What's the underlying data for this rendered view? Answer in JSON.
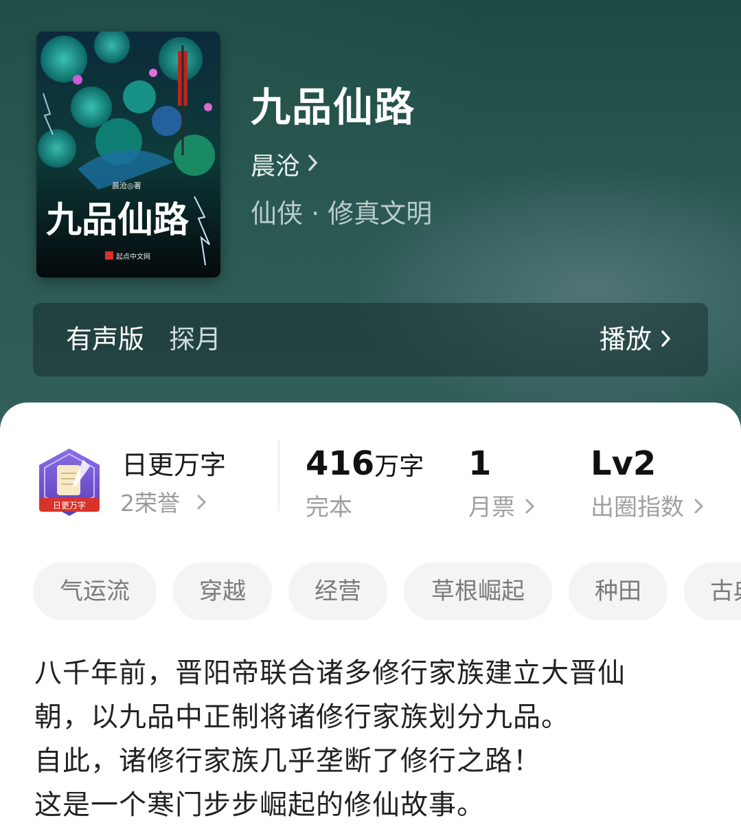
{
  "book": {
    "title": "九品仙路",
    "author": "晨沧",
    "genre": "仙侠 · 修真文明",
    "cover": {
      "title_text": "九品仙路",
      "author_text": "晨沧◎著",
      "publisher_text": "起点中文网"
    }
  },
  "audio": {
    "label": "有声版",
    "narrator": "探月",
    "play_label": "播放"
  },
  "honor": {
    "title": "日更万字",
    "count": "2荣誉",
    "badge_text": "日更万字"
  },
  "stats": [
    {
      "value": "416",
      "unit": "万字",
      "label": "完本"
    },
    {
      "value": "1",
      "unit": "",
      "label": "月票"
    },
    {
      "value": "Lv2",
      "unit": "",
      "label": "出圈指数"
    }
  ],
  "tags": [
    "气运流",
    "穿越",
    "经营",
    "草根崛起",
    "种田",
    "古典"
  ],
  "description": [
    "八千年前，晋阳帝联合诸多修行家族建立大晋仙",
    "朝，以九品中正制将诸修行家族划分九品。",
    "自此，诸修行家族几乎垄断了修行之路！",
    "这是一个寒门步步崛起的修仙故事。"
  ],
  "colors": {
    "hero_bg": "#2a5752",
    "sheet_bg": "#ffffff",
    "tag_bg": "#f4f4f4",
    "muted_text": "#9a9a9a",
    "accent_red": "#d8322a",
    "badge_purple": "#6b4fc9"
  },
  "icons": [
    "chevron-right-icon",
    "honor-badge-icon"
  ]
}
